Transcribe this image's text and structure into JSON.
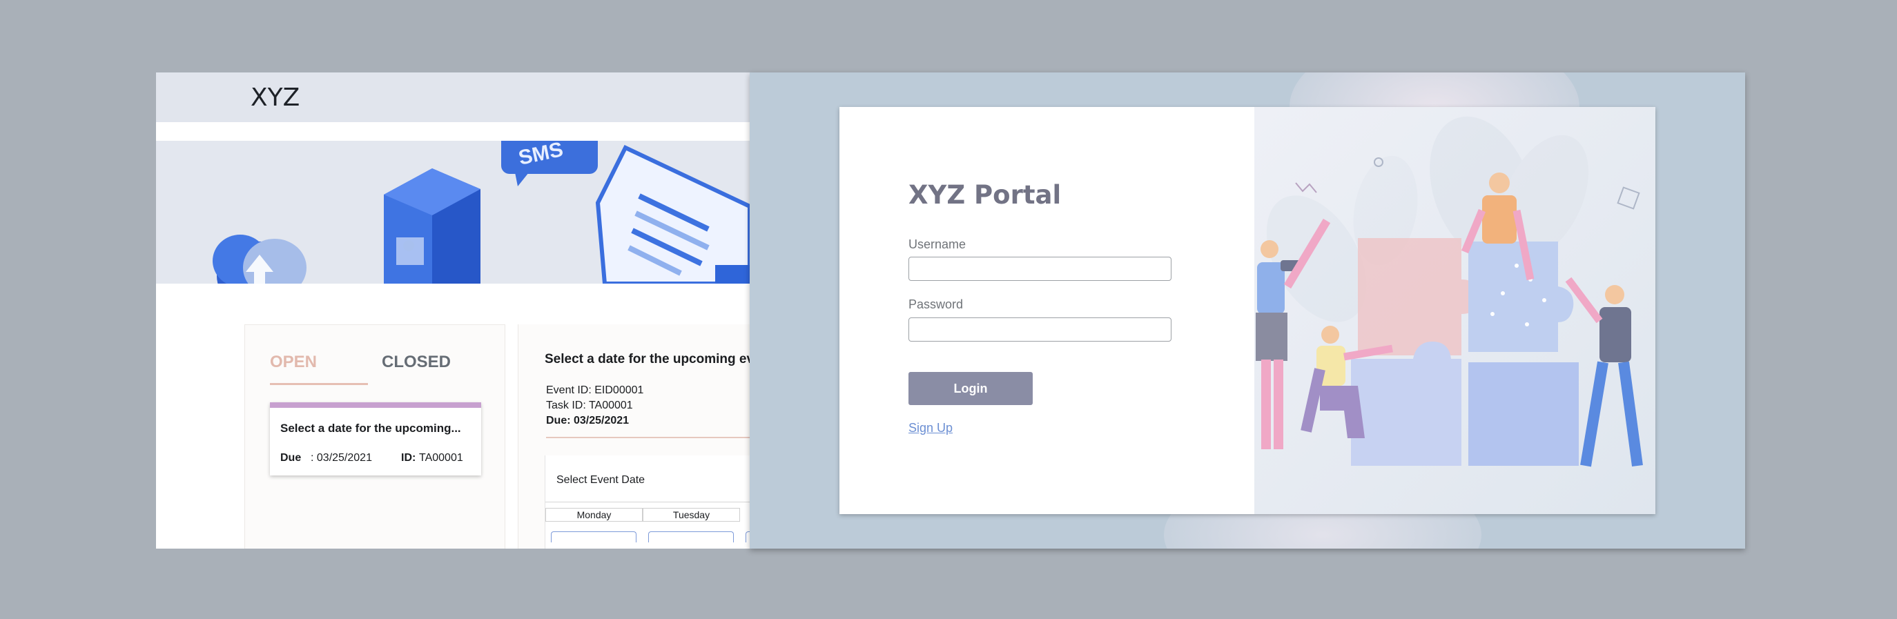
{
  "app": {
    "logo": "XYZ"
  },
  "tasks": {
    "tab_open": "OPEN",
    "tab_closed": "CLOSED",
    "item": {
      "title": "Select a date for the upcoming...",
      "due_label": "Due",
      "due_value": ":  03/25/2021",
      "id_label": "ID:",
      "id_value": "TA00001"
    }
  },
  "event": {
    "title": "Select a date for the upcoming ev",
    "event_id": "Event ID: EID00001",
    "task_id": "Task ID: TA00001",
    "due": "Due: 03/25/2021",
    "select_date_label": "Select Event Date",
    "days": [
      "Monday",
      "Tuesday"
    ]
  },
  "login": {
    "title": "XYZ Portal",
    "username_label": "Username",
    "username_value": "",
    "password_label": "Password",
    "password_value": "",
    "login_button": "Login",
    "signup_link": "Sign Up"
  },
  "colors": {
    "page_bg": "#a9b0b8",
    "tab_open": "#e2b9ad",
    "task_accent": "#c7a0cf",
    "login_button": "#8a8da5",
    "link": "#6c8fd3",
    "illustration_blue": "#2f6fe0"
  }
}
